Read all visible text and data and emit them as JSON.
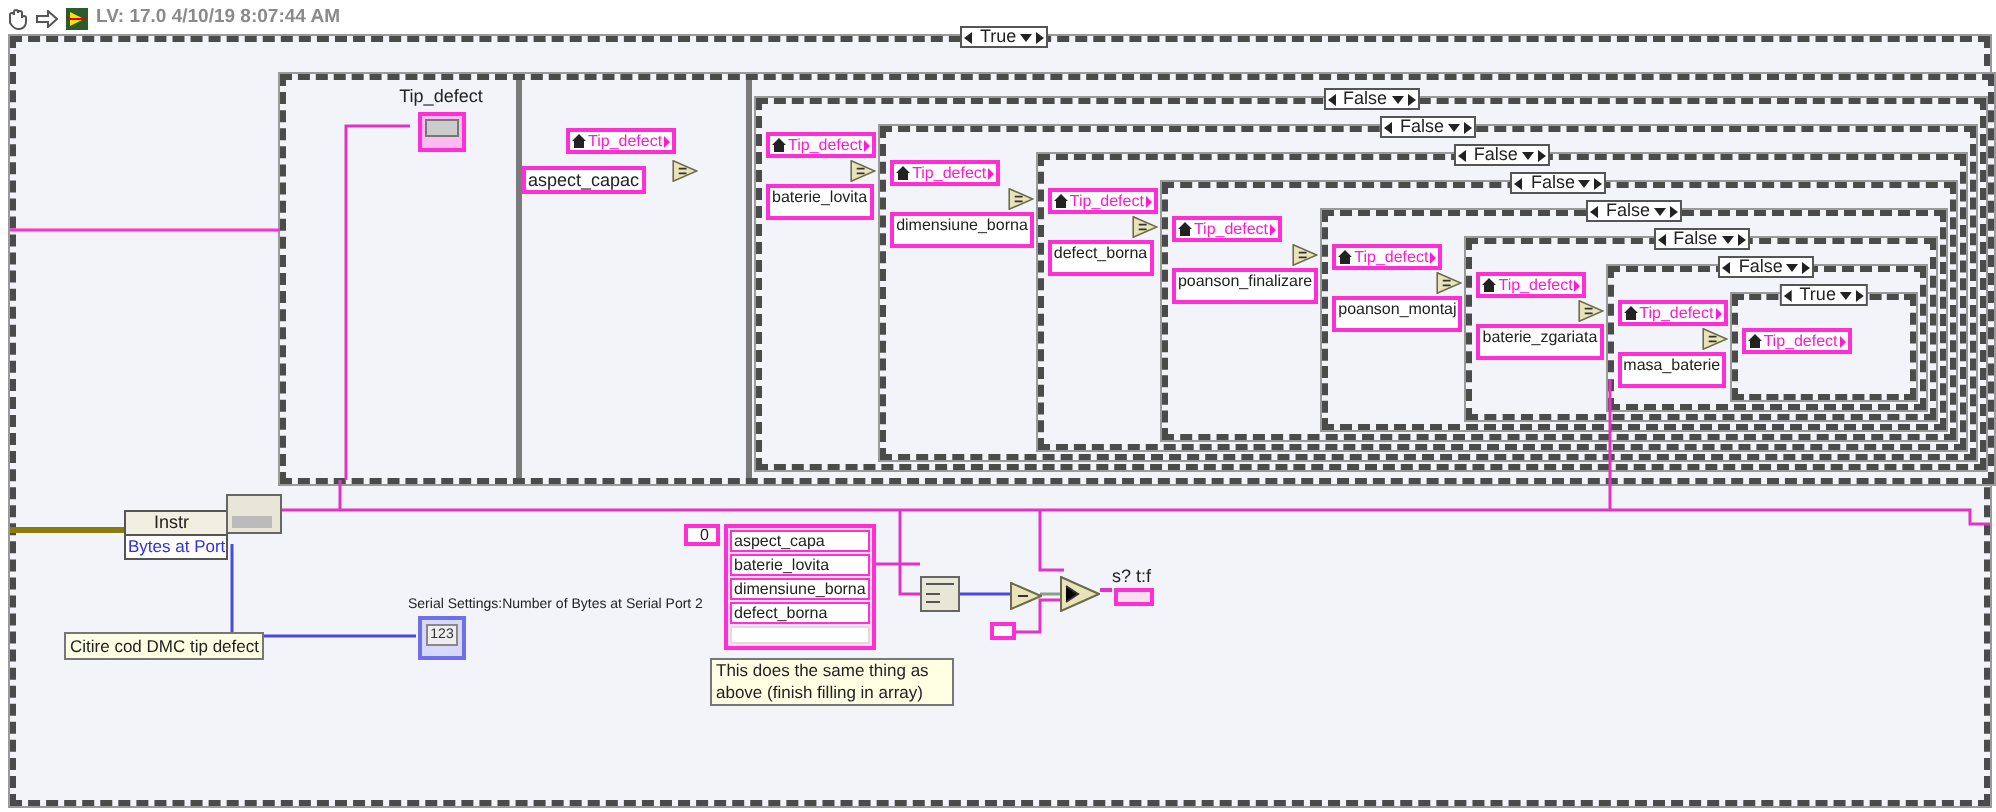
{
  "toolbar": {
    "version_stamp": "LV: 17.0 4/10/19 8:07:44 AM"
  },
  "outer_case": {
    "selector": "True"
  },
  "sequence": {
    "indicator_label": "Tip_defect",
    "local": "Tip_defect",
    "constant": "aspect_capac"
  },
  "nested_cases": [
    {
      "selector": "False",
      "local": "Tip_defect",
      "constant": "baterie_lovita"
    },
    {
      "selector": "False",
      "local": "Tip_defect",
      "constant": "dimensiune_borna"
    },
    {
      "selector": "False",
      "local": "Tip_defect",
      "constant": "defect_borna"
    },
    {
      "selector": "False",
      "local": "Tip_defect",
      "constant": "poanson_finalizare"
    },
    {
      "selector": "False",
      "local": "Tip_defect",
      "constant": "poanson_montaj"
    },
    {
      "selector": "False",
      "local": "Tip_defect",
      "constant": "baterie_zgariata"
    },
    {
      "selector": "False",
      "local": "Tip_defect",
      "constant": "masa_baterie"
    },
    {
      "selector": "True",
      "local": "Tip_defect"
    }
  ],
  "visa_node": {
    "label": "Instr",
    "property": "Bytes at Port"
  },
  "comment_read": "Citire cod DMC tip defect",
  "serial_indicator": {
    "label": "Serial Settings:Number of Bytes at Serial Port 2",
    "glyph": "123"
  },
  "array_constant": {
    "index": "0",
    "items": [
      "aspect_capa",
      "baterie_lovita",
      "dimensiune_borna",
      "defect_borna"
    ]
  },
  "comment_same": "This does the same thing as above (finish filling in array)",
  "result_indicator": {
    "label": "s? t:f"
  }
}
